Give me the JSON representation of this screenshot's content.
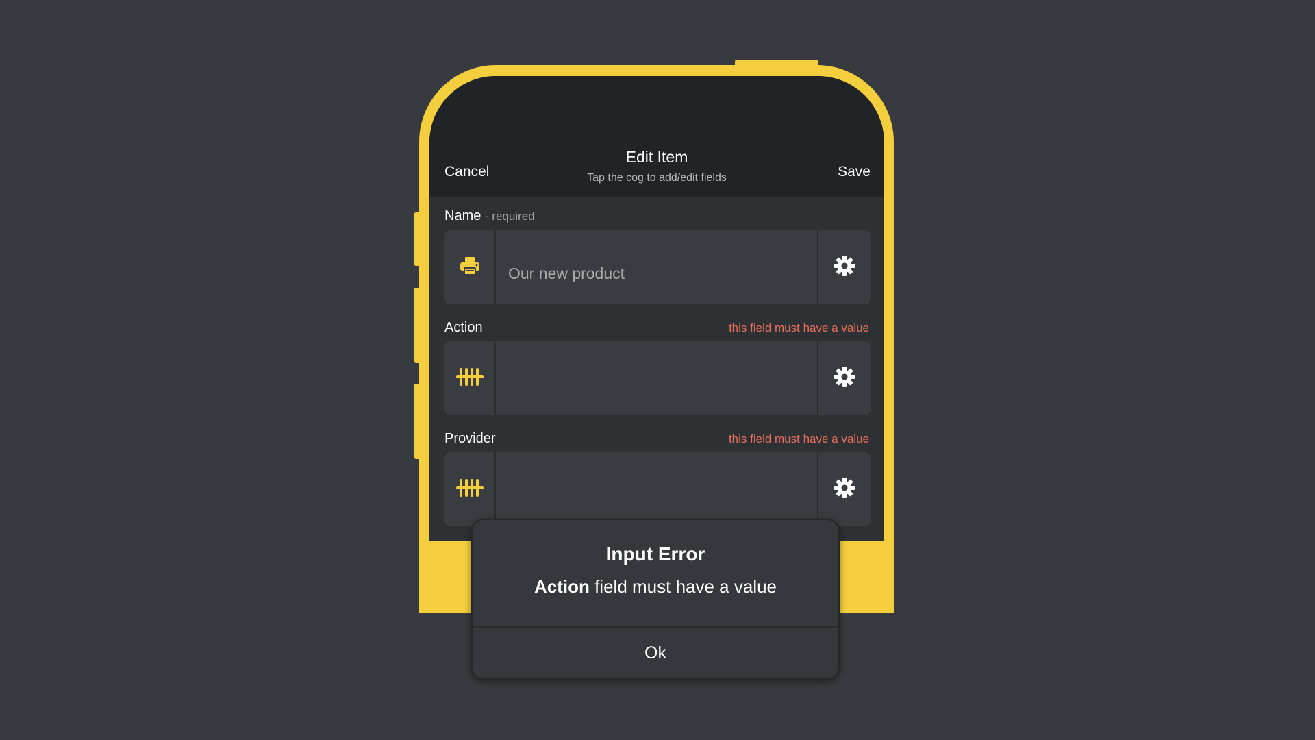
{
  "header": {
    "cancel_label": "Cancel",
    "title": "Edit Item",
    "subtitle": "Tap the cog to add/edit fields",
    "save_label": "Save"
  },
  "fields": {
    "name": {
      "label": "Name",
      "required_note": "- required",
      "value": "",
      "placeholder": "Our new product",
      "icon": "printer-icon",
      "error": ""
    },
    "action": {
      "label": "Action",
      "value": "",
      "placeholder": "",
      "icon": "tally-marks-icon",
      "error": "this field must have a value"
    },
    "provider": {
      "label": "Provider",
      "value": "",
      "placeholder": "",
      "icon": "tally-marks-icon",
      "error": "this field must have a value"
    }
  },
  "dialog": {
    "title": "Input Error",
    "message_field": "Action",
    "message_rest": " field must have a value",
    "ok_label": "Ok"
  },
  "colors": {
    "background": "#373a3e",
    "phone_frame": "#f5ce3e",
    "header": "#212426",
    "screen": "#2e3134",
    "field": "#393c40",
    "error_text": "#e8705a",
    "icon_accent": "#f5ce3e"
  }
}
